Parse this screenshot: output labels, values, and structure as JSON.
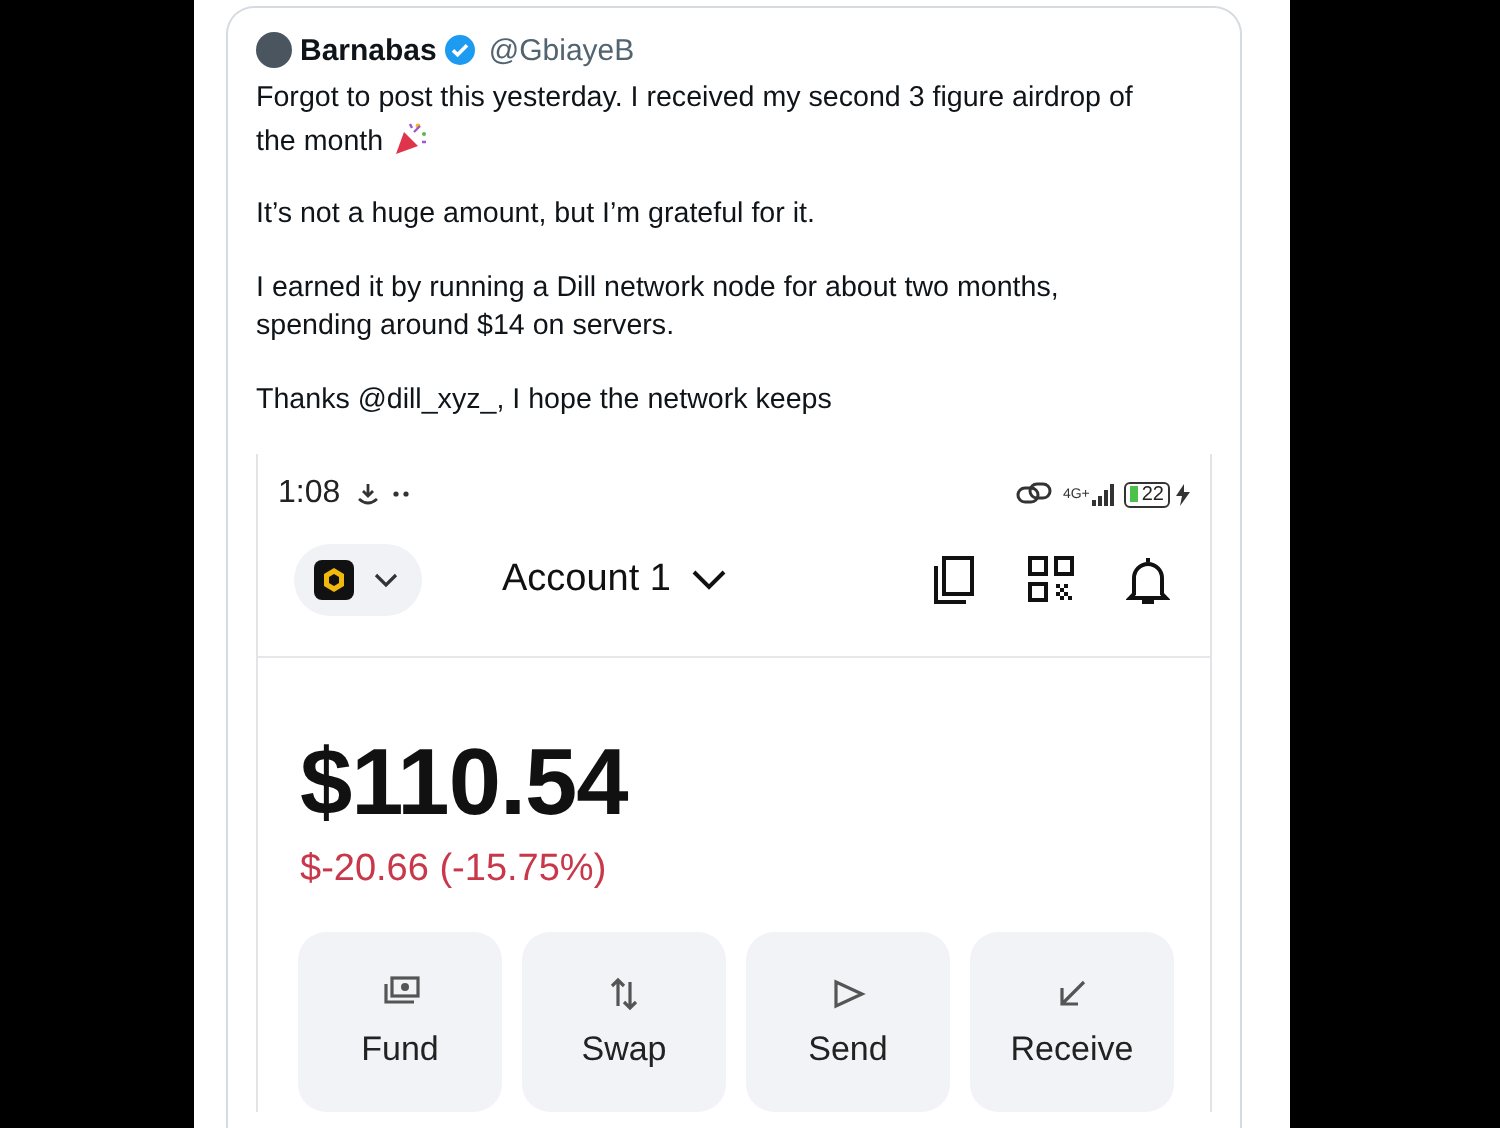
{
  "tweet": {
    "author": "Barnabas",
    "verified": true,
    "handle": "@GbiayeB",
    "paragraphs": [
      [
        "Forgot to post this yesterday. I received my second 3 figure airdrop of",
        "the month"
      ],
      [
        "It’s not a huge amount, but I’m grateful for it."
      ],
      [
        "I earned it by running a Dill network node for about two months,",
        "spending around $14 on servers."
      ],
      [
        "Thanks @dill_xyz_, I hope the network keeps"
      ]
    ]
  },
  "phone_status": {
    "time": "1:08",
    "network": "4G+",
    "battery": "22",
    "charging": true
  },
  "wallet": {
    "account": "Account 1",
    "balance": "$110.54",
    "change": "$-20.66 (-15.75%)",
    "actions": [
      {
        "kind": "fund",
        "label": "Fund"
      },
      {
        "kind": "swap",
        "label": "Swap"
      },
      {
        "kind": "send",
        "label": "Send"
      },
      {
        "kind": "receive",
        "label": "Receive"
      }
    ]
  }
}
